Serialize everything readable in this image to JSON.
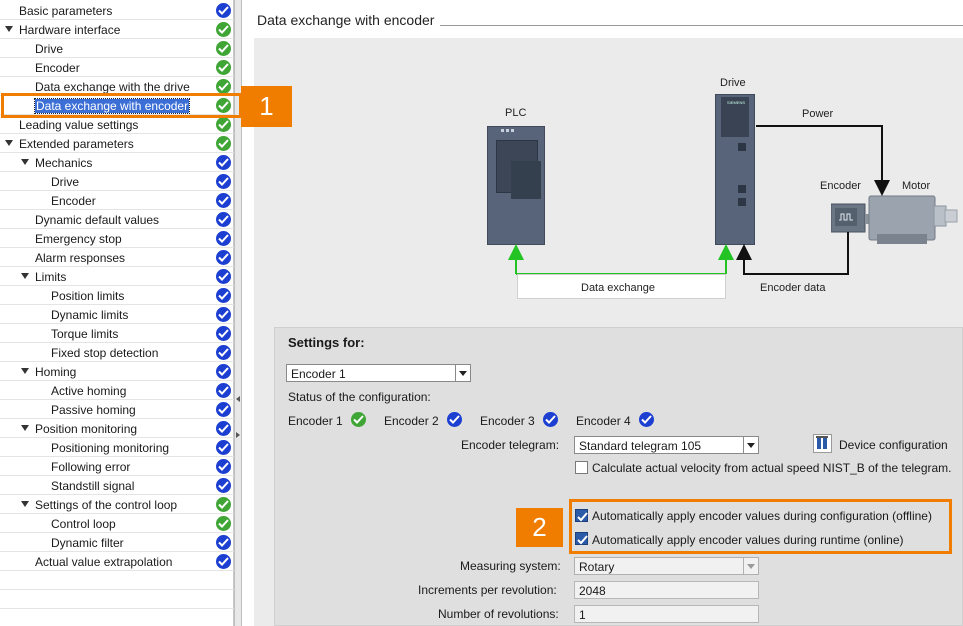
{
  "tree": {
    "items": [
      {
        "label": "Basic parameters",
        "level": 0,
        "expander": false,
        "status": "blue"
      },
      {
        "label": "Hardware interface",
        "level": 0,
        "expander": true,
        "status": "green"
      },
      {
        "label": "Drive",
        "level": 1,
        "expander": false,
        "status": "green"
      },
      {
        "label": "Encoder",
        "level": 1,
        "expander": false,
        "status": "green"
      },
      {
        "label": "Data exchange with the drive",
        "level": 1,
        "expander": false,
        "status": "green"
      },
      {
        "label": "Data exchange with encoder",
        "level": 1,
        "expander": false,
        "status": "green",
        "selected": true
      },
      {
        "label": "Leading value settings",
        "level": 0,
        "expander": false,
        "status": "green"
      },
      {
        "label": "Extended parameters",
        "level": 0,
        "expander": true,
        "status": "green"
      },
      {
        "label": "Mechanics",
        "level": 1,
        "expander": true,
        "status": "blue"
      },
      {
        "label": "Drive",
        "level": 2,
        "expander": false,
        "status": "blue"
      },
      {
        "label": "Encoder",
        "level": 2,
        "expander": false,
        "status": "blue"
      },
      {
        "label": "Dynamic default values",
        "level": 1,
        "expander": false,
        "status": "blue"
      },
      {
        "label": "Emergency stop",
        "level": 1,
        "expander": false,
        "status": "blue"
      },
      {
        "label": "Alarm responses",
        "level": 1,
        "expander": false,
        "status": "blue"
      },
      {
        "label": "Limits",
        "level": 1,
        "expander": true,
        "status": "blue"
      },
      {
        "label": "Position limits",
        "level": 2,
        "expander": false,
        "status": "blue"
      },
      {
        "label": "Dynamic limits",
        "level": 2,
        "expander": false,
        "status": "blue"
      },
      {
        "label": "Torque limits",
        "level": 2,
        "expander": false,
        "status": "blue"
      },
      {
        "label": "Fixed stop detection",
        "level": 2,
        "expander": false,
        "status": "blue"
      },
      {
        "label": "Homing",
        "level": 1,
        "expander": true,
        "status": "blue"
      },
      {
        "label": "Active homing",
        "level": 2,
        "expander": false,
        "status": "blue"
      },
      {
        "label": "Passive homing",
        "level": 2,
        "expander": false,
        "status": "blue"
      },
      {
        "label": "Position monitoring",
        "level": 1,
        "expander": true,
        "status": "blue"
      },
      {
        "label": "Positioning monitoring",
        "level": 2,
        "expander": false,
        "status": "blue"
      },
      {
        "label": "Following error",
        "level": 2,
        "expander": false,
        "status": "blue"
      },
      {
        "label": "Standstill signal",
        "level": 2,
        "expander": false,
        "status": "blue"
      },
      {
        "label": "Settings of the control loop",
        "level": 1,
        "expander": true,
        "status": "green"
      },
      {
        "label": "Control loop",
        "level": 2,
        "expander": false,
        "status": "green"
      },
      {
        "label": "Dynamic filter",
        "level": 2,
        "expander": false,
        "status": "blue"
      },
      {
        "label": "Actual value extrapolation",
        "level": 1,
        "expander": false,
        "status": "blue"
      }
    ]
  },
  "main": {
    "title": "Data exchange with encoder",
    "diagram": {
      "plc": "PLC",
      "drive": "Drive",
      "power": "Power",
      "encoder": "Encoder",
      "motor": "Motor",
      "data_exchange": "Data exchange",
      "encoder_data": "Encoder data",
      "brand": "SIEMENS"
    },
    "settings": {
      "heading": "Settings for:",
      "selected_encoder": "Encoder 1",
      "status_label": "Status of the configuration:",
      "encoders": [
        {
          "label": "Encoder 1",
          "status": "green"
        },
        {
          "label": "Encoder 2",
          "status": "blue"
        },
        {
          "label": "Encoder 3",
          "status": "blue"
        },
        {
          "label": "Encoder 4",
          "status": "blue"
        }
      ],
      "telegram_label": "Encoder telegram:",
      "telegram_value": "Standard telegram 105",
      "device_config": "Device configuration",
      "calc_velocity": "Calculate actual velocity from actual speed NIST_B of the telegram.",
      "calc_velocity_checked": false,
      "auto_offline": "Automatically apply encoder values during configuration (offline)",
      "auto_offline_checked": true,
      "auto_online": "Automatically apply encoder values during runtime (online)",
      "auto_online_checked": true,
      "measuring_label": "Measuring system:",
      "measuring_value": "Rotary",
      "increments_label": "Increments per revolution:",
      "increments_value": "2048",
      "revolutions_label": "Number of revolutions:",
      "revolutions_value": "1"
    }
  },
  "callouts": {
    "one": "1",
    "two": "2"
  },
  "colors": {
    "accent_orange": "#f07d00",
    "status_green": "#3fa535",
    "status_blue": "#1c3fd2",
    "selection_blue": "#3c6fd6",
    "arrow_green": "#22c322"
  }
}
